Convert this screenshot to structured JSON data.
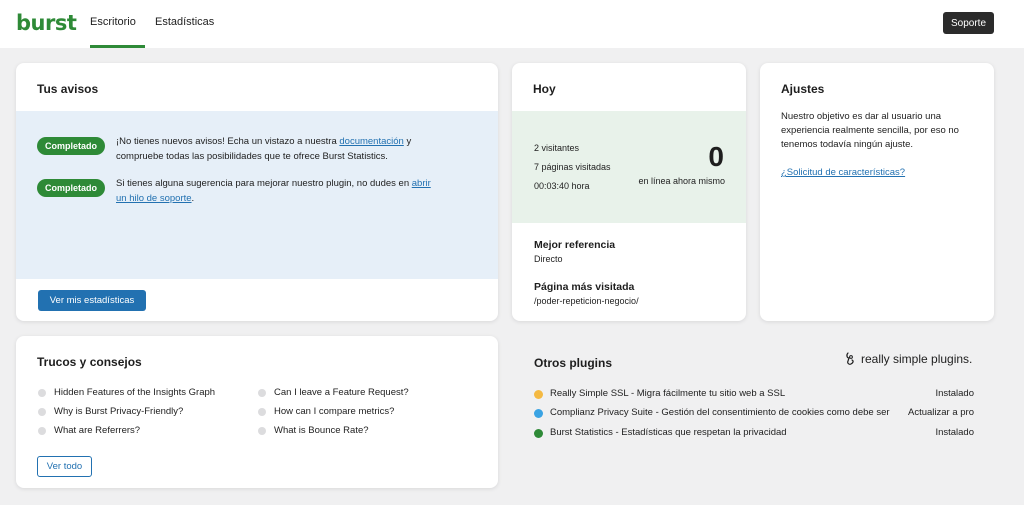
{
  "header": {
    "logo": "burst",
    "tabs": [
      {
        "label": "Escritorio",
        "active": true
      },
      {
        "label": "Estadísticas",
        "active": false
      }
    ],
    "support_label": "Soporte",
    "accent_color": "#2e8a37"
  },
  "notices": {
    "title": "Tus avisos",
    "items": [
      {
        "badge": "Completado",
        "text_before": "¡No tienes nuevos avisos! Echa un vistazo a nuestra ",
        "link": "documentación",
        "text_after": " y compruebe todas las posibilidades que te ofrece Burst Statistics."
      },
      {
        "badge": "Completado",
        "text_before": "Si tienes alguna sugerencia para mejorar nuestro plugin, no dudes en ",
        "link": "abrir un hilo de soporte",
        "text_after": "."
      }
    ],
    "button_label": "Ver mis estadísticas"
  },
  "today": {
    "title": "Hoy",
    "visitors": "2 visitantes",
    "pages_visited": "7 páginas visitadas",
    "time": "00:03:40 hora",
    "live_count": "0",
    "live_label": "en línea ahora mismo",
    "top_referrer_label": "Mejor referencia",
    "top_referrer_value": "Directo",
    "top_page_label": "Página más visitada",
    "top_page_value": "/poder-repeticion-negocio/"
  },
  "settings": {
    "title": "Ajustes",
    "text": "Nuestro objetivo es dar al usuario una experiencia realmente sencilla, por eso no tenemos todavía ningún ajuste.",
    "link": "¿Solicitud de características?"
  },
  "tips": {
    "title": "Trucos y consejos",
    "left": [
      "Hidden Features of the Insights Graph",
      "Why is Burst Privacy-Friendly?",
      "What are Referrers?"
    ],
    "right": [
      "Can I leave a Feature Request?",
      "How can I compare metrics?",
      "What is Bounce Rate?"
    ],
    "button_label": "Ver todo"
  },
  "plugins": {
    "title": "Otros plugins",
    "brand": "really simple plugins.",
    "items": [
      {
        "name": "Really Simple SSL - Migra fácilmente tu sitio web a SSL",
        "status": "Instalado",
        "color": "#f4b942"
      },
      {
        "name": "Complianz Privacy Suite - Gestión del consentimiento de cookies como debe ser",
        "status": "Actualizar a pro",
        "color": "#3aa3e3"
      },
      {
        "name": "Burst Statistics - Estadísticas que respetan la privacidad",
        "status": "Instalado",
        "color": "#2e8a37"
      }
    ]
  }
}
